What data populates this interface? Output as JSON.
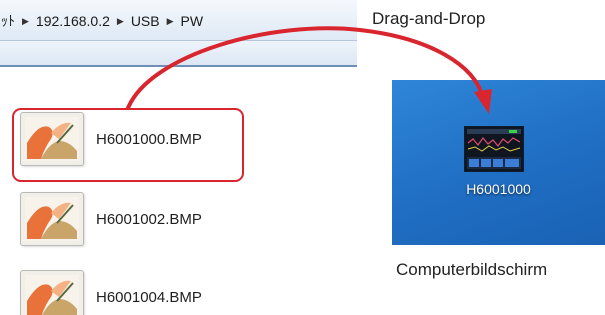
{
  "explorer": {
    "breadcrumbs": [
      "ｯﾄ",
      "192.168.0.2",
      "USB",
      "PW"
    ],
    "files": [
      {
        "name": "H6001000.BMP",
        "icon": "bitmap-image-icon"
      },
      {
        "name": "H6001002.BMP",
        "icon": "bitmap-image-icon"
      },
      {
        "name": "H6001004.BMP",
        "icon": "bitmap-image-icon"
      }
    ]
  },
  "desktop": {
    "icon_label": "H6001000",
    "icon": "screenshot-bitmap-icon"
  },
  "annotations": {
    "drag_label": "Drag-and-Drop",
    "screen_label": "Computerbildschirm",
    "accent_color": "#d9262e"
  }
}
